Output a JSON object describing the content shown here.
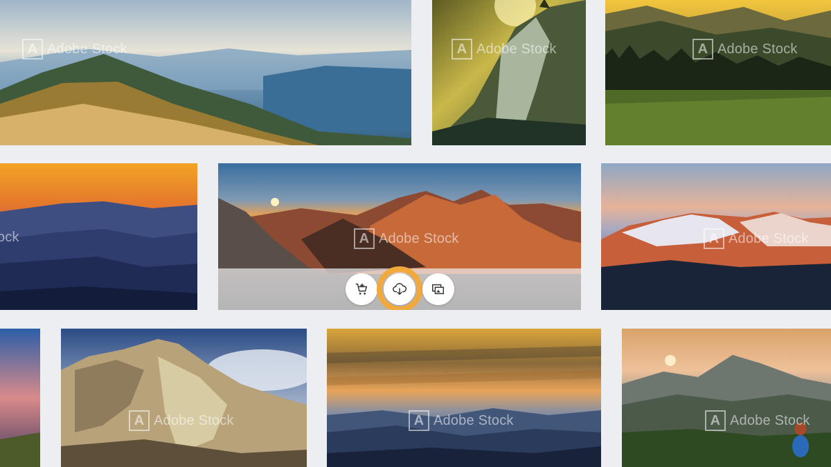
{
  "watermark_text": "Adobe Stock",
  "watermark_logo": "A",
  "watermark_partial": "ock",
  "actions": {
    "add_to_cart_icon": "cart-plus-icon",
    "download_icon": "cloud-download-icon",
    "find_similar_icon": "similar-images-icon"
  },
  "colors": {
    "background": "#eceef2",
    "highlight": "#f2a93b",
    "button": "#ffffff"
  },
  "tiles": [
    {
      "name": "image-tile-mountain-sea-of-clouds"
    },
    {
      "name": "image-tile-waterfall-cliff"
    },
    {
      "name": "image-tile-green-meadow-forest"
    },
    {
      "name": "image-tile-blue-ridges-sunset"
    },
    {
      "name": "image-tile-alpine-panorama-sunrise"
    },
    {
      "name": "image-tile-snowy-peaks-alpenglow"
    },
    {
      "name": "image-tile-twilight-partial"
    },
    {
      "name": "image-tile-rocky-peak"
    },
    {
      "name": "image-tile-golden-sky-ridges"
    },
    {
      "name": "image-tile-hiker-meditation"
    }
  ]
}
